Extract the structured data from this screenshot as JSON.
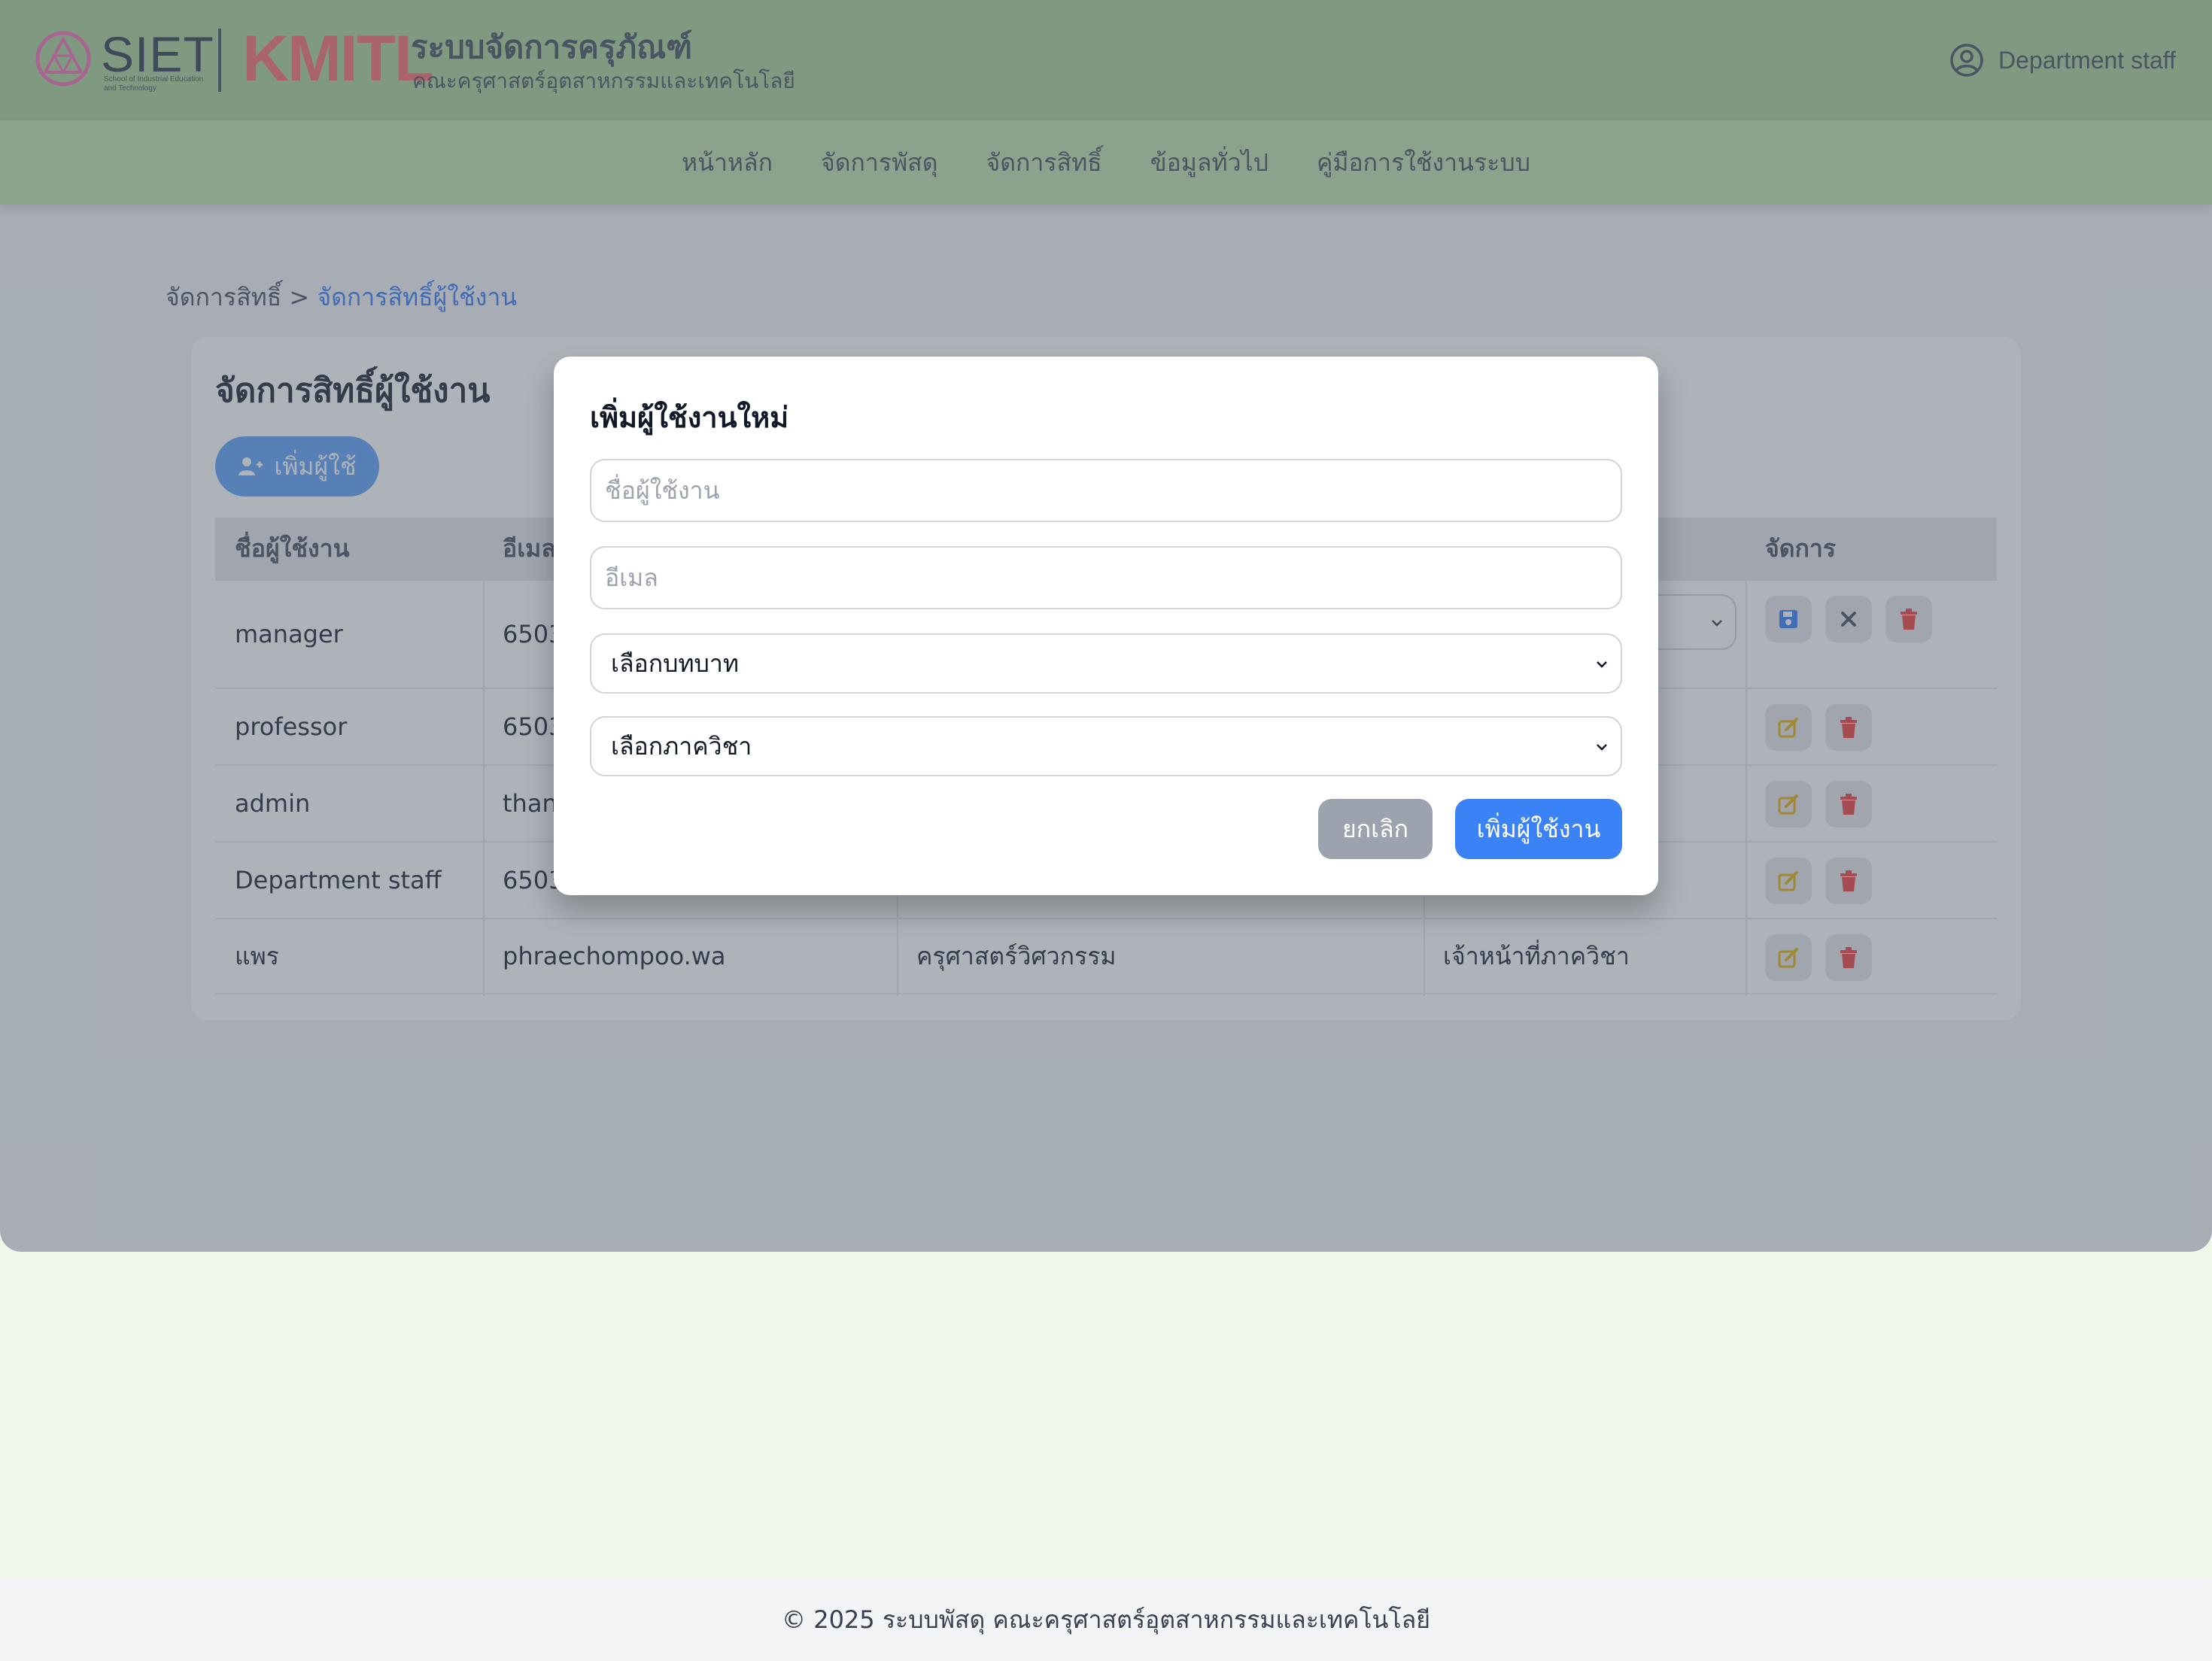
{
  "header": {
    "siet_logo_text": "SIET",
    "siet_logo_sub": "School of Industrial Education and Technology",
    "kmitl_logo_text": "KMITL",
    "system_title": "ระบบจัดการครุภัณฑ์",
    "system_subtitle": "คณะครุศาสตร์อุตสาหกรรมและเทคโนโลยี",
    "user_icon": "user-circle-icon",
    "user_name": "Department staff"
  },
  "nav": {
    "items": [
      {
        "label": "หน้าหลัก"
      },
      {
        "label": "จัดการพัสดุ"
      },
      {
        "label": "จัดการสิทธิ์"
      },
      {
        "label": "ข้อมูลทั่วไป"
      },
      {
        "label": "คู่มือการใช้งานระบบ"
      }
    ]
  },
  "breadcrumb": {
    "parent": "จัดการสิทธิ์",
    "separator": ">",
    "current": "จัดการสิทธิ์ผู้ใช้งาน"
  },
  "page": {
    "title": "จัดการสิทธิ์ผู้ใช้งาน",
    "add_user_label": "เพิ่มผู้ใช้",
    "add_user_icon": "user-plus-icon"
  },
  "table": {
    "columns": [
      "ชื่อผู้ใช้งาน",
      "อีเมล",
      "",
      "",
      "จัดการ"
    ],
    "rows": [
      {
        "username": "manager",
        "email": "6503",
        "department": "",
        "role": "",
        "editing": true,
        "actions": [
          "save-icon",
          "close-icon",
          "trash-icon"
        ]
      },
      {
        "username": "professor",
        "email": "6503",
        "department": "",
        "role": "",
        "editing": false,
        "actions": [
          "edit-icon",
          "trash-icon"
        ]
      },
      {
        "username": "admin",
        "email": "thanc",
        "department": "",
        "role": "",
        "editing": false,
        "actions": [
          "edit-icon",
          "trash-icon"
        ]
      },
      {
        "username": "Department staff",
        "email": "6503",
        "department": "",
        "role": "",
        "editing": false,
        "actions": [
          "edit-icon",
          "trash-icon"
        ]
      },
      {
        "username": "แพร",
        "email": "phraechompoo.wa",
        "department": "ครุศาสตร์วิศวกรรม",
        "role": "เจ้าหน้าที่ภาควิชา",
        "editing": false,
        "actions": [
          "edit-icon",
          "trash-icon"
        ]
      }
    ]
  },
  "modal": {
    "title": "เพิ่มผู้ใช้งานใหม่",
    "username_placeholder": "ชื่อผู้ใช้งาน",
    "email_placeholder": "อีเมล",
    "role_select": "เลือกบทบาท",
    "department_select": "เลือกภาควิชา",
    "cancel_label": "ยกเลิก",
    "submit_label": "เพิ่มผู้ใช้งาน"
  },
  "colors": {
    "header_bg": "#abd39a",
    "nav_bg": "#bfe3ad",
    "accent": "#3b82f6",
    "danger": "#ef4444",
    "edit": "#eab308"
  },
  "footer": {
    "text": "© 2025 ระบบพัสดุ คณะครุศาสตร์อุตสาหกรรมและเทคโนโลยี"
  }
}
